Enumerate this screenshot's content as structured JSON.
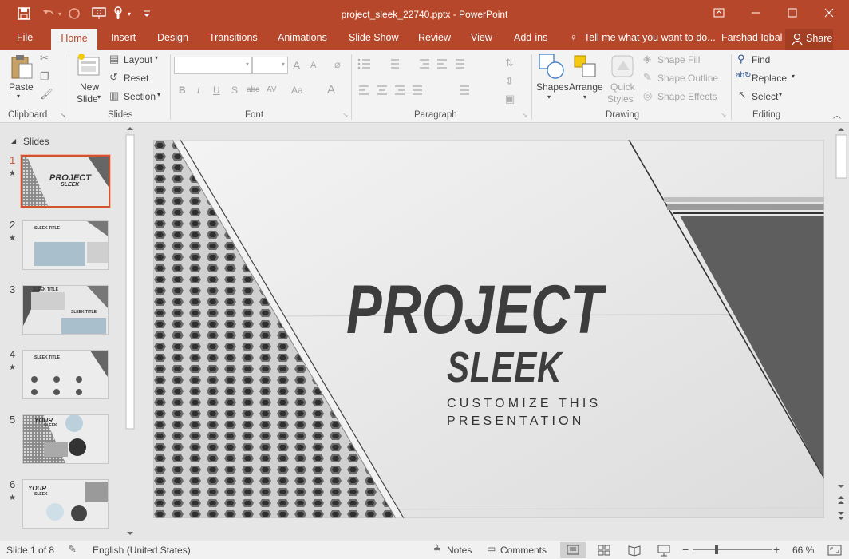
{
  "window": {
    "title": "project_sleek_22740.pptx - PowerPoint"
  },
  "tabs": {
    "file": "File",
    "home": "Home",
    "insert": "Insert",
    "design": "Design",
    "transitions": "Transitions",
    "animations": "Animations",
    "slideshow": "Slide Show",
    "review": "Review",
    "view": "View",
    "addins": "Add-ins",
    "tellme": "Tell me what you want to do...",
    "user": "Farshad Iqbal",
    "share": "Share"
  },
  "ribbon": {
    "clipboard": {
      "paste": "Paste",
      "label": "Clipboard"
    },
    "slides": {
      "new_slide_1": "New",
      "new_slide_2": "Slide",
      "layout": "Layout",
      "reset": "Reset",
      "section": "Section",
      "label": "Slides"
    },
    "font": {
      "label": "Font",
      "bold": "B",
      "italic": "I",
      "underline": "U",
      "shadow": "S",
      "strike": "abc",
      "spacing": "AV",
      "case": "Aa",
      "color": "A",
      "grow": "A",
      "shrink": "A"
    },
    "paragraph": {
      "label": "Paragraph"
    },
    "drawing": {
      "shapes": "Shapes",
      "arrange": "Arrange",
      "quick_1": "Quick",
      "quick_2": "Styles",
      "fill": "Shape Fill",
      "outline": "Shape Outline",
      "effects": "Shape Effects",
      "label": "Drawing"
    },
    "editing": {
      "find": "Find",
      "replace": "Replace",
      "select": "Select",
      "label": "Editing"
    }
  },
  "slides_panel": {
    "header": "Slides",
    "thumbs": [
      {
        "num": "1",
        "title": "PROJECT",
        "sub": "SLEEK"
      },
      {
        "num": "2",
        "title": "SLEEK TITLE"
      },
      {
        "num": "3",
        "title": "SLEEK TITLE",
        "sub": "SLEEK TITLE"
      },
      {
        "num": "4",
        "title": "SLEEK TITLE"
      },
      {
        "num": "5",
        "title": "YOUR",
        "sub": "SLEEK"
      },
      {
        "num": "6",
        "title": "YOUR",
        "sub": "SLEEK"
      }
    ]
  },
  "slide": {
    "title": "PROJECT",
    "subtitle": "SLEEK",
    "tag1": "CUSTOMIZE THIS",
    "tag2": "PRESENTATION"
  },
  "status": {
    "slide": "Slide 1 of 8",
    "language": "English (United States)",
    "notes": "Notes",
    "comments": "Comments",
    "zoom": "66 %"
  }
}
